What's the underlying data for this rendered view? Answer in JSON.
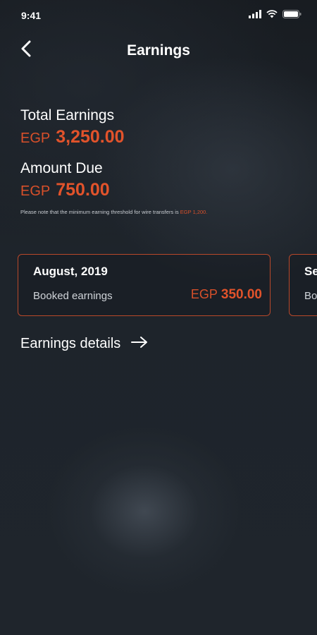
{
  "status_bar": {
    "time": "9:41"
  },
  "header": {
    "title": "Earnings"
  },
  "summary": {
    "total_label": "Total Earnings",
    "total_currency": "EGP",
    "total_value": "3,250.00",
    "due_label": "Amount Due",
    "due_currency": "EGP",
    "due_value": "750.00",
    "note_text": "Please note that the minimum earning threshold for wire transfers is",
    "note_amount": "EGP 1,200."
  },
  "cards": [
    {
      "title": "August, 2019",
      "label": "Booked earnings",
      "currency": "EGP",
      "value": "350.00"
    },
    {
      "title": "Se",
      "label": "Bo"
    }
  ],
  "details_link": {
    "label": "Earnings details"
  },
  "colors": {
    "accent": "#e2532b",
    "background": "#1c2128"
  }
}
